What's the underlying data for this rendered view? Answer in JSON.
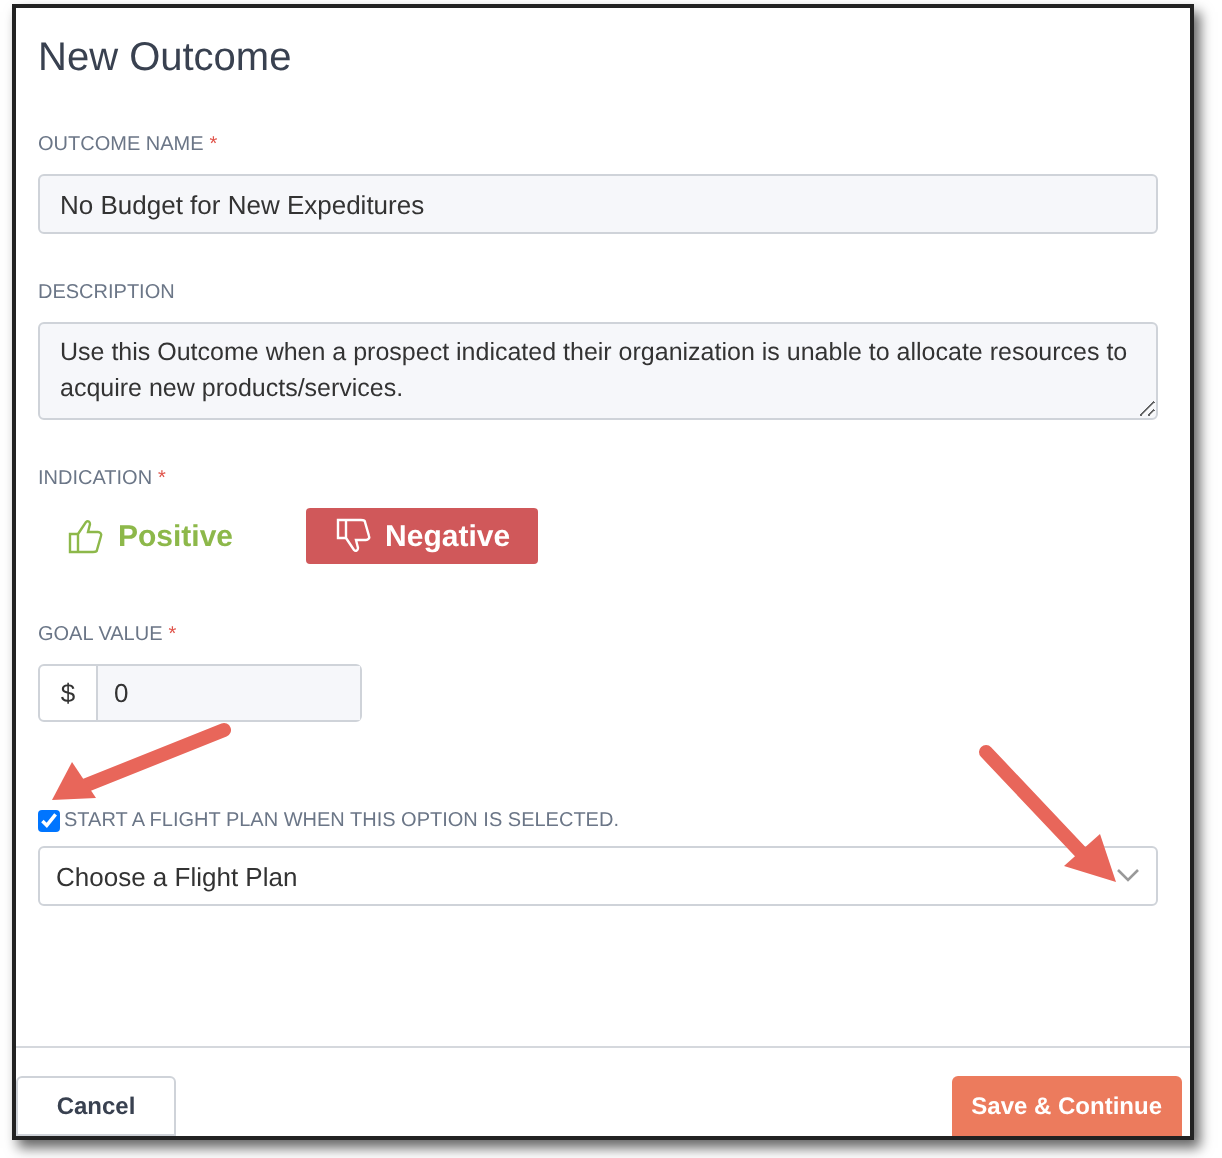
{
  "title": "New Outcome",
  "outcome_name": {
    "label": "OUTCOME NAME",
    "required_mark": "*",
    "value": "No Budget for New Expeditures"
  },
  "description": {
    "label": "DESCRIPTION",
    "value": "Use this Outcome when a prospect indicated their organization is unable to allocate resources to acquire new products/services."
  },
  "indication": {
    "label": "INDICATION",
    "required_mark": "*",
    "options": [
      {
        "kind": "positive",
        "label": "Positive",
        "selected": false
      },
      {
        "kind": "negative",
        "label": "Negative",
        "selected": true
      }
    ]
  },
  "goal_value": {
    "label": "GOAL VALUE",
    "required_mark": "*",
    "prefix": "$",
    "value": "0"
  },
  "flight_plan": {
    "checked": true,
    "label": "START A FLIGHT PLAN WHEN THIS OPTION IS SELECTED.",
    "placeholder": "Choose a Flight Plan"
  },
  "buttons": {
    "cancel": "Cancel",
    "save": "Save & Continue"
  }
}
